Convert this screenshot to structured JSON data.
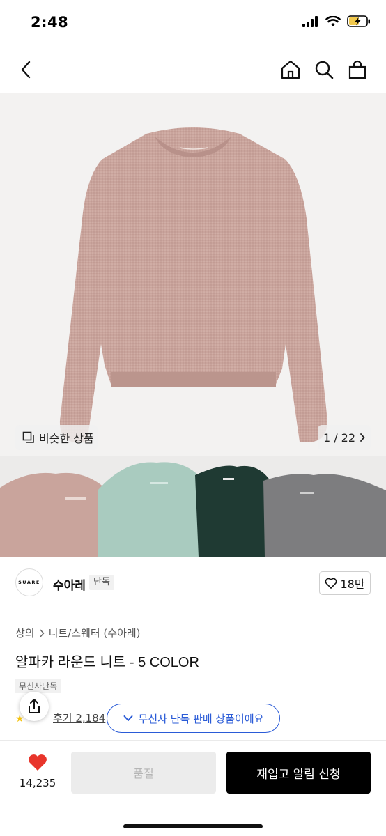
{
  "status_bar": {
    "time": "2:48",
    "icons": [
      "signal-icon",
      "wifi-icon",
      "battery-charging-icon"
    ]
  },
  "nav": {
    "icons": [
      "back-chevron-icon",
      "home-icon",
      "search-icon",
      "shopping-bag-icon"
    ]
  },
  "hero": {
    "similar_label": "비슷한 상품",
    "page_indicator": "1 / 22",
    "main_sweater_color": "#c9a49c",
    "variant_colors": [
      "#c9a49c",
      "#a9cbbf",
      "#1f3a33",
      "#7d7d7f"
    ]
  },
  "brand": {
    "logo_text": "SUARE",
    "name": "수아레",
    "badge": "단독",
    "likes": "18만"
  },
  "product": {
    "breadcrumb": [
      "상의",
      "니트/스웨터 (수아레)"
    ],
    "title": "알파카 라운드 니트 - 5 COLOR",
    "exclusive_badge": "무신사단독",
    "review_link": "후기 2,184",
    "tooltip": "무신사 단독 판매 상품이에요"
  },
  "bottom": {
    "heart_count": "14,235",
    "soldout_label": "품절",
    "restock_label": "재입고 알림 신청"
  },
  "colors": {
    "accent_blue": "#2a5bd7",
    "heart_red": "#e8352b",
    "primary_black": "#000000"
  }
}
